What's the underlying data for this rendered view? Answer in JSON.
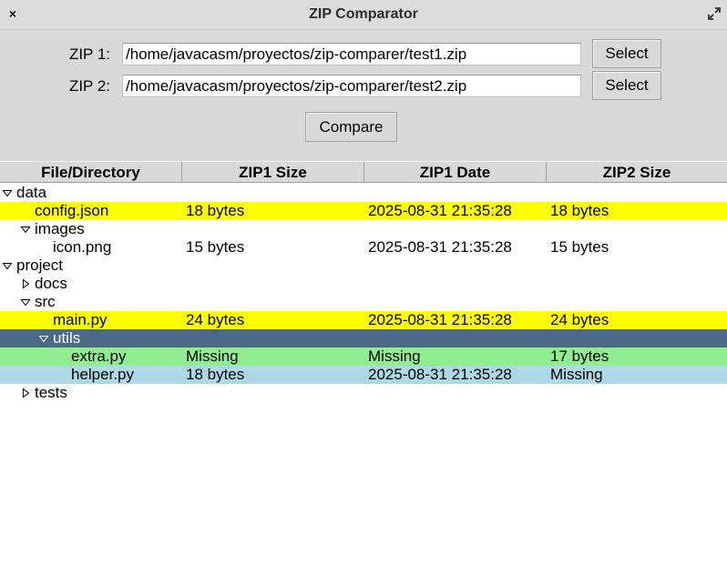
{
  "window": {
    "title": "ZIP Comparator",
    "close_glyph": "×",
    "icons": {
      "close": "close-icon",
      "maximize": "maximize-icon"
    }
  },
  "form": {
    "zip1_label": "ZIP 1:",
    "zip1_value": "/home/javacasm/proyectos/zip-comparer/test1.zip",
    "zip2_label": "ZIP 2:",
    "zip2_value": "/home/javacasm/proyectos/zip-comparer/test2.zip",
    "select1_label": "Select",
    "select2_label": "Select",
    "compare_label": "Compare"
  },
  "tree": {
    "columns": [
      "File/Directory",
      "ZIP1 Size",
      "ZIP1 Date",
      "ZIP2 Size"
    ],
    "rows": [
      {
        "name": "data",
        "level": 0,
        "expander": "expanded",
        "zip1_size": "",
        "zip1_date": "",
        "zip2_size": "",
        "status": ""
      },
      {
        "name": "config.json",
        "level": 1,
        "expander": "none",
        "zip1_size": "18 bytes",
        "zip1_date": "2025-08-31 21:35:28",
        "zip2_size": "18 bytes",
        "status": "changed"
      },
      {
        "name": "images",
        "level": 1,
        "expander": "expanded",
        "zip1_size": "",
        "zip1_date": "",
        "zip2_size": "",
        "status": ""
      },
      {
        "name": "icon.png",
        "level": 2,
        "expander": "none",
        "zip1_size": "15 bytes",
        "zip1_date": "2025-08-31 21:35:28",
        "zip2_size": "15 bytes",
        "status": ""
      },
      {
        "name": "project",
        "level": 0,
        "expander": "expanded",
        "zip1_size": "",
        "zip1_date": "",
        "zip2_size": "",
        "status": ""
      },
      {
        "name": "docs",
        "level": 1,
        "expander": "collapsed",
        "zip1_size": "",
        "zip1_date": "",
        "zip2_size": "",
        "status": ""
      },
      {
        "name": "src",
        "level": 1,
        "expander": "expanded",
        "zip1_size": "",
        "zip1_date": "",
        "zip2_size": "",
        "status": ""
      },
      {
        "name": "main.py",
        "level": 2,
        "expander": "none",
        "zip1_size": "24 bytes",
        "zip1_date": "2025-08-31 21:35:28",
        "zip2_size": "24 bytes",
        "status": "changed"
      },
      {
        "name": "utils",
        "level": 2,
        "expander": "expanded",
        "zip1_size": "",
        "zip1_date": "",
        "zip2_size": "",
        "status": "selected"
      },
      {
        "name": "extra.py",
        "level": 3,
        "expander": "none",
        "zip1_size": "Missing",
        "zip1_date": "Missing",
        "zip2_size": "17 bytes",
        "status": "added"
      },
      {
        "name": "helper.py",
        "level": 3,
        "expander": "none",
        "zip1_size": "18 bytes",
        "zip1_date": "2025-08-31 21:35:28",
        "zip2_size": "Missing",
        "status": "removed"
      },
      {
        "name": "tests",
        "level": 1,
        "expander": "collapsed",
        "zip1_size": "",
        "zip1_date": "",
        "zip2_size": "",
        "status": ""
      }
    ]
  },
  "colors": {
    "changed": "#ffff00",
    "selected": "#4a6984",
    "added": "#90ee90",
    "removed": "#add8e6"
  }
}
